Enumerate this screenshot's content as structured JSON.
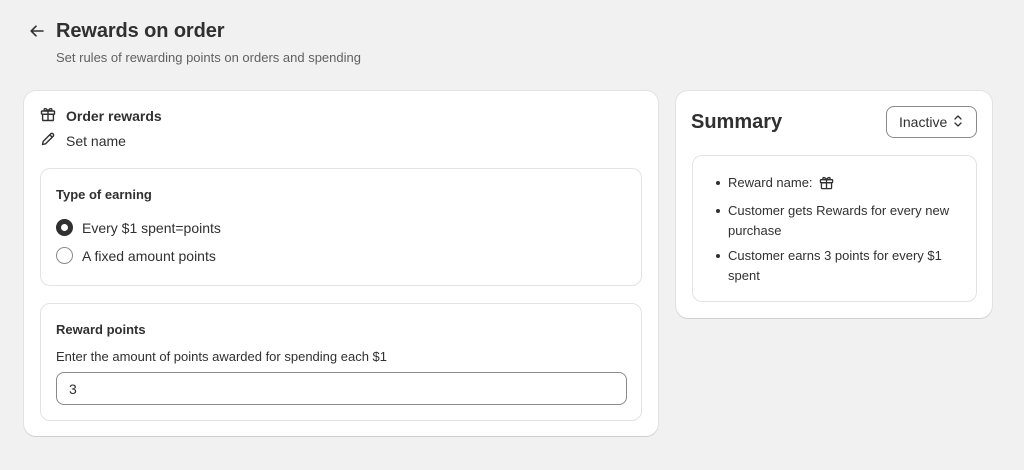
{
  "header": {
    "back_icon": "arrow-left-icon",
    "title": "Rewards on order",
    "subtitle": "Set rules of rewarding points on orders and spending"
  },
  "main": {
    "order_rewards_label": "Order rewards",
    "order_rewards_icon": "gift-icon",
    "set_name_label": "Set name",
    "set_name_icon": "pencil-icon",
    "earning": {
      "heading": "Type of earning",
      "options": [
        {
          "label": "Every $1 spent=points",
          "selected": true
        },
        {
          "label": "A fixed amount points",
          "selected": false
        }
      ]
    },
    "points": {
      "heading": "Reward points",
      "field_label": "Enter the amount of points awarded for spending each $1",
      "value": "3"
    }
  },
  "summary": {
    "title": "Summary",
    "status": "Inactive",
    "status_icon": "select-chevrons-icon",
    "items": [
      {
        "text": "Reward name:",
        "icon": "gift-icon"
      },
      {
        "text": "Customer gets Rewards for every new purchase"
      },
      {
        "text": "Customer earns 3 points for every $1 spent"
      }
    ]
  },
  "colors": {
    "page_background": "#f1f1f1",
    "card_background": "#ffffff",
    "text_primary": "#303030",
    "text_secondary": "#616161",
    "border": "#e3e3e3",
    "input_border": "#8a8a8a"
  }
}
